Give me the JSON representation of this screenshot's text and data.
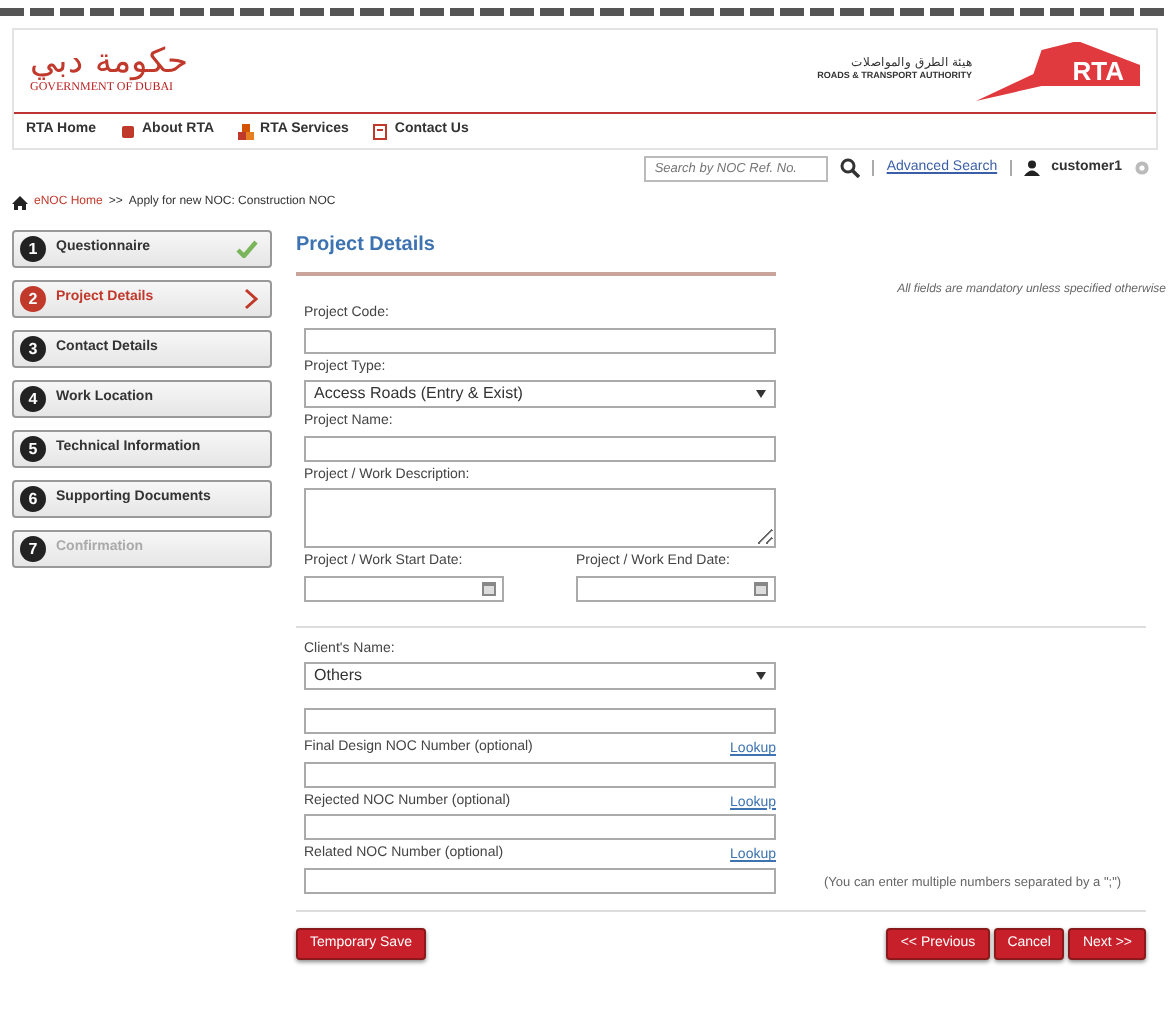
{
  "header": {
    "gov_logo_arabic": "حكومة دبي",
    "gov_logo_text": "GOVERNMENT OF DUBAI",
    "rta_arabic": "هيئة الطرق والمواصلات",
    "rta_english": "ROADS & TRANSPORT AUTHORITY",
    "rta_logo": "RTA"
  },
  "nav": [
    {
      "label": "RTA Home"
    },
    {
      "label": "About RTA"
    },
    {
      "label": "RTA Services"
    },
    {
      "label": "Contact Us"
    }
  ],
  "search": {
    "placeholder": "Search by NOC Ref. No.",
    "advanced": "Advanced Search",
    "user": "customer1"
  },
  "breadcrumb": {
    "home": "eNOC Home",
    "separator": ">>",
    "current": "Apply for new NOC: Construction NOC"
  },
  "steps": [
    {
      "number": "1",
      "label": "Questionnaire",
      "completed": true,
      "selected": false,
      "disabled": false
    },
    {
      "number": "2",
      "label": "Project Details",
      "completed": false,
      "selected": true,
      "disabled": false
    },
    {
      "number": "3",
      "label": "Contact Details",
      "completed": false,
      "selected": false,
      "disabled": false
    },
    {
      "number": "4",
      "label": "Work Location",
      "completed": false,
      "selected": false,
      "disabled": false
    },
    {
      "number": "5",
      "label": "Technical Information",
      "completed": false,
      "selected": false,
      "disabled": false
    },
    {
      "number": "6",
      "label": "Supporting Documents",
      "completed": false,
      "selected": false,
      "disabled": false
    },
    {
      "number": "7",
      "label": "Confirmation",
      "completed": false,
      "selected": false,
      "disabled": true
    }
  ],
  "form": {
    "title": "Project Details",
    "note": "All fields are mandatory unless specified otherwise",
    "fields": [
      {
        "kind": "text",
        "label": "Project Code:"
      },
      {
        "kind": "select",
        "label": "Project Type:",
        "value": "Access Roads (Entry & Exist)"
      },
      {
        "kind": "text",
        "label": "Project Name:"
      },
      {
        "kind": "textarea",
        "label": "Project / Work Description:"
      },
      {
        "kind": "dates",
        "label": "Project / Work Start Date:",
        "label_2": "Project / Work End Date:"
      }
    ],
    "fields_2": [
      {
        "kind": "select",
        "label": "Client's Name:",
        "value": "Others"
      },
      {
        "kind": "text"
      },
      {
        "kind": "text",
        "label": "Final Design NOC Number (optional)",
        "link": "Lookup"
      },
      {
        "kind": "text",
        "label": "Rejected NOC Number (optional)",
        "link": "Lookup"
      },
      {
        "kind": "text",
        "label": "Related NOC Number (optional)",
        "link": "Lookup",
        "hint": "(You can enter multiple numbers separated by a \";\")"
      }
    ]
  },
  "buttons": {
    "left": "Temporary Save",
    "right": [
      "<< Previous",
      "Cancel",
      "Next >>"
    ]
  }
}
